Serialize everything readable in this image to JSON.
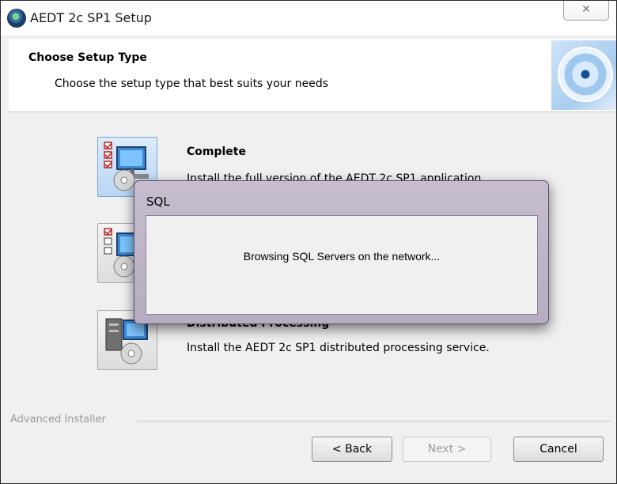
{
  "window": {
    "title": "AEDT 2c SP1 Setup",
    "close_glyph": "✕"
  },
  "header": {
    "title": "Choose Setup Type",
    "subtitle": "Choose the setup type that best suits your needs"
  },
  "options": [
    {
      "title": "Complete",
      "description": "Install the full version of the AEDT 2c SP1 application."
    },
    {
      "title": "Distributed Processing",
      "description": "Install the AEDT 2c SP1 distributed processing service."
    }
  ],
  "footer": {
    "brand": "Advanced Installer",
    "back_label": "< Back",
    "next_label": "Next >",
    "cancel_label": "Cancel"
  },
  "dialog": {
    "title": "SQL",
    "message": "Browsing SQL Servers on the network..."
  },
  "colors": {
    "dialog_frame": "#b6aec0",
    "icon_selected_bg": "#b9d6f3"
  }
}
